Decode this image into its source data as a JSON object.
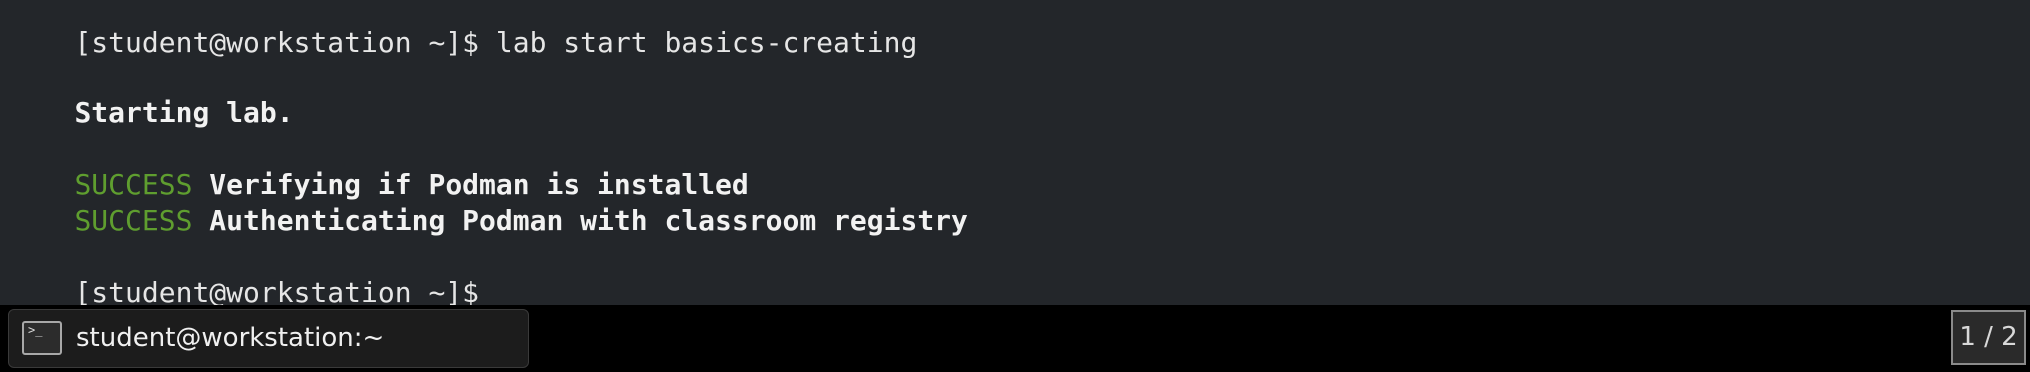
{
  "terminal": {
    "lines": [
      {
        "text": "[student@workstation ~]$ lab start basics-creating"
      },
      {
        "text": "Starting lab."
      },
      {
        "status": "SUCCESS",
        "text": " Verifying if Podman is installed"
      },
      {
        "status": "SUCCESS",
        "text": " Authenticating Podman with classroom registry"
      },
      {
        "text": "[student@workstation ~]$ "
      }
    ]
  },
  "taskbar": {
    "window_title": "student@workstation:~",
    "window_icon": "terminal-icon",
    "workspace_indicator": "1 / 2"
  },
  "colors": {
    "terminal_background": "#23262a",
    "taskbar_background": "#000000",
    "success": "#5f9e2f"
  }
}
